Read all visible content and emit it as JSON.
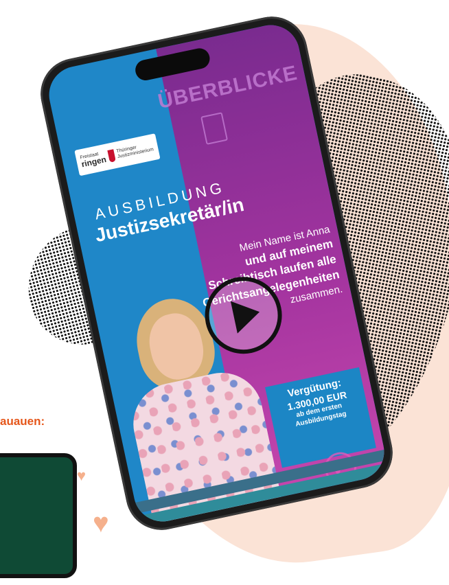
{
  "side_label": "auauen:",
  "screen": {
    "overview_text": "ÜBERBLICKE",
    "logo": {
      "small": "Freistaat",
      "main": "ringen",
      "crest_text": "Thüringer Justizministerium"
    },
    "title_line1": "AUSBILDUNG",
    "title_line2": "Justizsekretär/in",
    "intro": {
      "line1": "Mein Name ist Anna",
      "line2": "und auf meinem",
      "line3": "Schreibtisch laufen alle",
      "line4": "Gerichtsangelegenheiten",
      "line5": "zusammen."
    },
    "pay": {
      "heading": "Vergütung:",
      "amount": "1.300,00 EUR",
      "sub1": "ab dem ersten",
      "sub2": "Ausbildungstag"
    }
  },
  "colors": {
    "accent_orange": "#e5561a",
    "purple": "#a3349f",
    "blue": "#1f87c8",
    "green": "#0f4a35"
  },
  "icons": [
    "play-icon",
    "document-icon",
    "check-icon",
    "heart-icon"
  ]
}
